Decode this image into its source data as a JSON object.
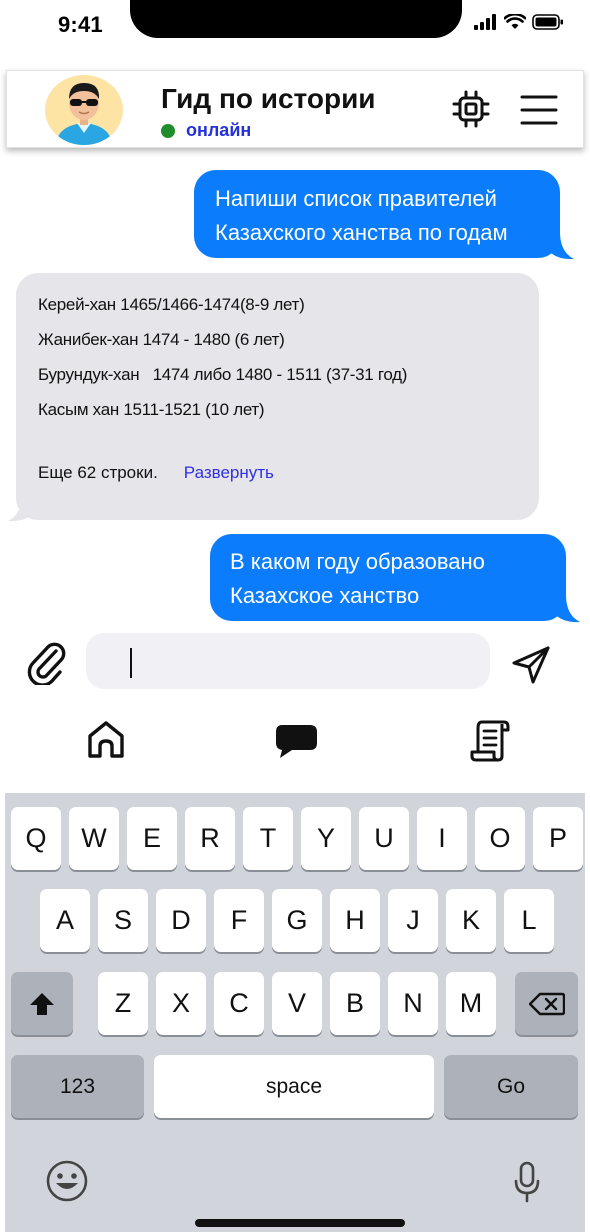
{
  "status_bar": {
    "time": "9:41"
  },
  "header": {
    "title": "Гид по истории",
    "status": "онлайн",
    "chip_icon": "chip-icon",
    "menu_icon": "hamburger-menu-icon"
  },
  "messages": [
    {
      "direction": "outgoing",
      "lines": [
        "Напиши список правителей",
        "Казахского ханства по годам"
      ]
    },
    {
      "direction": "incoming",
      "lines": [
        "Керей-хан 1465/1466-1474(8-9 лет)",
        "Жанибек-хан 1474 - 1480 (6 лет)",
        "Бурундук-хан   1474 либо 1480 - 1511 (37-31 год)",
        "Касым хан 1511-1521 (10 лет)"
      ],
      "more_text": "Еще 62 строки.",
      "expand_label": "Развернуть"
    },
    {
      "direction": "outgoing",
      "lines": [
        "В каком году образовано",
        "Казахское ханство"
      ]
    }
  ],
  "composer": {
    "value": "",
    "attach_icon": "paperclip-icon",
    "send_icon": "send-icon"
  },
  "tabs": [
    {
      "icon": "home-icon",
      "active": false
    },
    {
      "icon": "chat-bubble-icon",
      "active": true
    },
    {
      "icon": "scroll-icon",
      "active": false
    }
  ],
  "keyboard": {
    "row1": [
      "Q",
      "W",
      "E",
      "R",
      "T",
      "Y",
      "U",
      "I",
      "O",
      "P"
    ],
    "row2": [
      "A",
      "S",
      "D",
      "F",
      "G",
      "H",
      "J",
      "K",
      "L"
    ],
    "row3": [
      "Z",
      "X",
      "C",
      "V",
      "B",
      "N",
      "M"
    ],
    "numbers_label": "123",
    "space_label": "space",
    "go_label": "Go"
  },
  "colors": {
    "outgoing_bubble": "#0a7cfc",
    "incoming_bubble": "#e6e5ea",
    "online_dot": "#1f8d2c",
    "online_text": "#2431d8",
    "link": "#2f2fe6",
    "keyboard_bg": "#d1d4db"
  }
}
